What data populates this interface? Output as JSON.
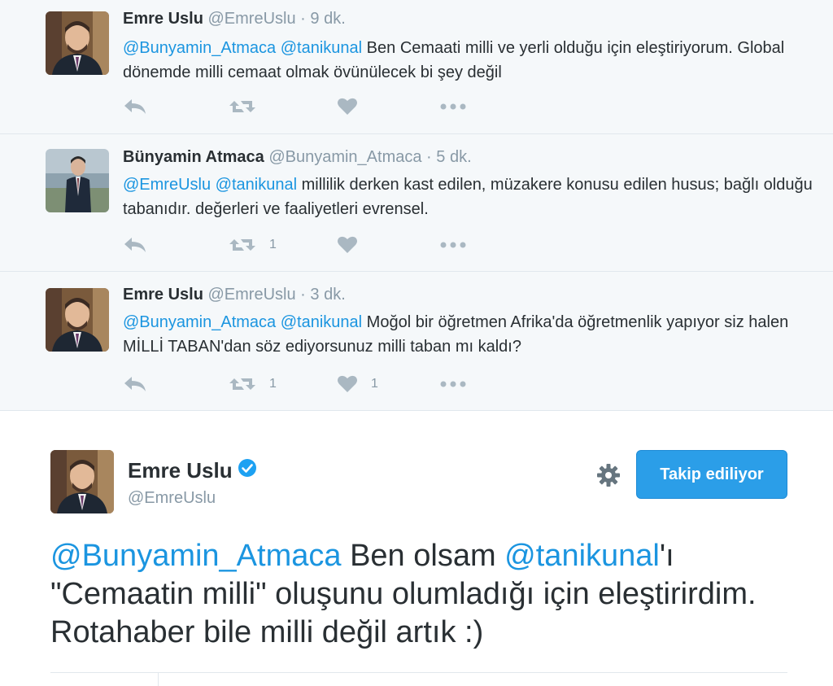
{
  "tweets": [
    {
      "name": "Emre Uslu",
      "handle": "@EmreUslu",
      "dot": "·",
      "time": "9 dk.",
      "mentions": [
        "@Bunyamin_Atmaca",
        "@tanikunal"
      ],
      "text": "Ben Cemaati milli ve yerli olduğu için eleştiriyorum. Global dönemde milli cemaat olmak övünülecek bi şey değil",
      "retweets": "",
      "likes": "",
      "avatar": "avatar-emre"
    },
    {
      "name": "Bünyamin Atmaca",
      "handle": "@Bunyamin_Atmaca",
      "dot": "·",
      "time": "5 dk.",
      "mentions": [
        "@EmreUslu",
        "@tanikunal"
      ],
      "text": "millilik derken kast edilen, müzakere konusu edilen husus; bağlı olduğu tabanıdır. değerleri ve faaliyetleri evrensel.",
      "retweets": "1",
      "likes": "",
      "avatar": "avatar-bunyamin"
    },
    {
      "name": "Emre Uslu",
      "handle": "@EmreUslu",
      "dot": "·",
      "time": "3 dk.",
      "mentions": [
        "@Bunyamin_Atmaca",
        "@tanikunal"
      ],
      "text": "Moğol bir öğretmen Afrika'da öğretmenlik yapıyor siz halen MİLLİ TABAN'dan söz ediyorsunuz milli taban mı kaldı?",
      "retweets": "1",
      "likes": "1",
      "avatar": "avatar-emre"
    }
  ],
  "main_tweet": {
    "name": "Emre Uslu",
    "verified_icon": "verified-badge-icon",
    "handle": "@EmreUslu",
    "follow_label": "Takip ediliyor",
    "settings_icon": "gear-icon",
    "mention1": "@Bunyamin_Atmaca",
    "text1": " Ben olsam ",
    "mention2": "@tanikunal",
    "text2": "'ı \"Cemaatin milli\" oluşunu olumladığı için eleştirirdim. Rotahaber bile milli değil artık :)"
  },
  "icons": {
    "reply": "reply-icon",
    "retweet": "retweet-icon",
    "like": "heart-icon",
    "more": "more-icon"
  },
  "colors": {
    "link": "#1b95e0",
    "muted": "#8899a6",
    "action": "#aab8c2",
    "follow_button": "#2b9ee8",
    "thread_bg": "#f5f8fa"
  }
}
